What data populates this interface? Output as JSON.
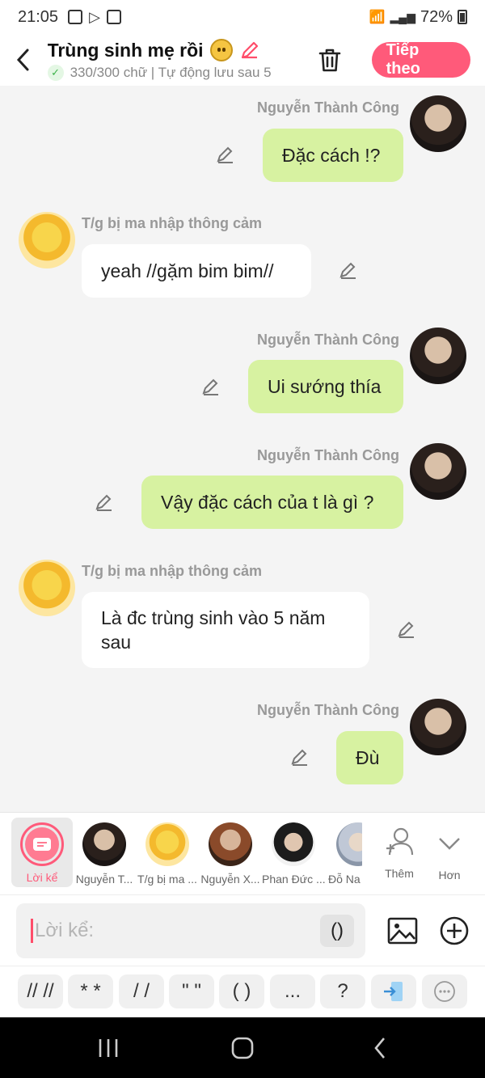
{
  "status_bar": {
    "time": "21:05",
    "battery": "72%"
  },
  "header": {
    "title": "Trùng sinh mẹ rồi",
    "subtitle": "330/300 chữ | Tự động lưu sau 5",
    "next_button": "Tiếp theo"
  },
  "messages": [
    {
      "sender": "Nguyễn Thành Công",
      "text": "Đặc cách !?",
      "side": "right"
    },
    {
      "sender": "T/g bị ma nhập thông cảm",
      "text": "yeah //gặm bim bim//",
      "side": "left"
    },
    {
      "sender": "Nguyễn Thành Công",
      "text": "Ui sướng thía",
      "side": "right"
    },
    {
      "sender": "Nguyễn Thành Công",
      "text": "Vậy đặc cách của t là gì ?",
      "side": "right"
    },
    {
      "sender": "T/g bị ma nhập thông cảm",
      "text_line1": "Là đc trùng sinh vào 5 năm",
      "text_line2": "sau",
      "side": "left"
    },
    {
      "sender": "Nguyễn Thành Công",
      "text": "Đù",
      "side": "right"
    }
  ],
  "character_bar": {
    "items": [
      "Lời kể",
      "Nguyễn T...",
      "T/g bị ma ...",
      "Nguyễn X...",
      "Phan Đức ...",
      "Đỗ Na"
    ],
    "add_label": "Thêm",
    "more_label": "Hơn"
  },
  "input": {
    "placeholder": "Lời kể:",
    "paren_button": "()"
  },
  "quick_symbols": [
    "// //",
    "* *",
    "/ /",
    "\" \"",
    "( )",
    "...",
    "?"
  ]
}
